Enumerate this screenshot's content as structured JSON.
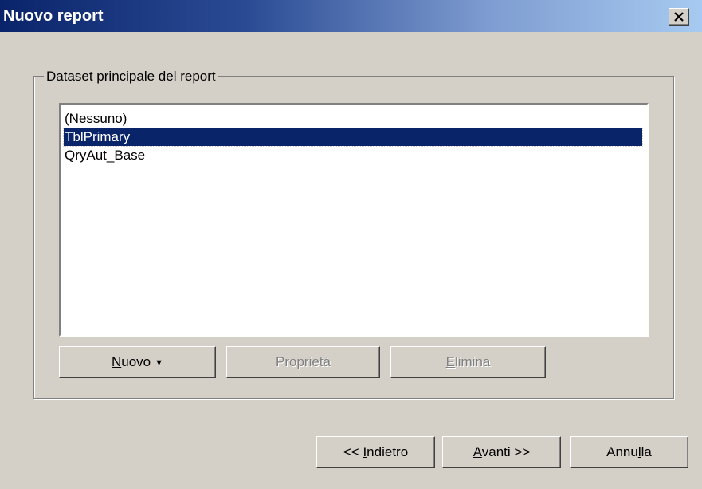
{
  "window": {
    "title": "Nuovo report",
    "close_icon": "close-icon"
  },
  "group": {
    "label": "Dataset principale del report"
  },
  "list": {
    "items": [
      "(Nessuno)",
      "TblPrimary",
      "QryAut_Base"
    ],
    "selected": "TblPrimary"
  },
  "dataset_buttons": {
    "new": {
      "mnemonic": "N",
      "rest": "uovo",
      "dropdown_icon": "dropdown-arrow-icon"
    },
    "properties": {
      "label": "Proprietà",
      "enabled": false
    },
    "delete": {
      "mnemonic": "E",
      "rest": "limina",
      "enabled": false
    }
  },
  "nav_buttons": {
    "back": {
      "prefix": "<< ",
      "mnemonic": "I",
      "rest": "ndietro"
    },
    "next": {
      "mnemonic": "A",
      "rest": "vanti >>"
    },
    "cancel": {
      "prefix": "Annu",
      "mnemonic": "l",
      "rest": "la"
    }
  },
  "colors": {
    "dialog_bg": "#d4d0c8",
    "title_start": "#0a246a",
    "title_end": "#a6caf0",
    "selection": "#0a246a"
  }
}
